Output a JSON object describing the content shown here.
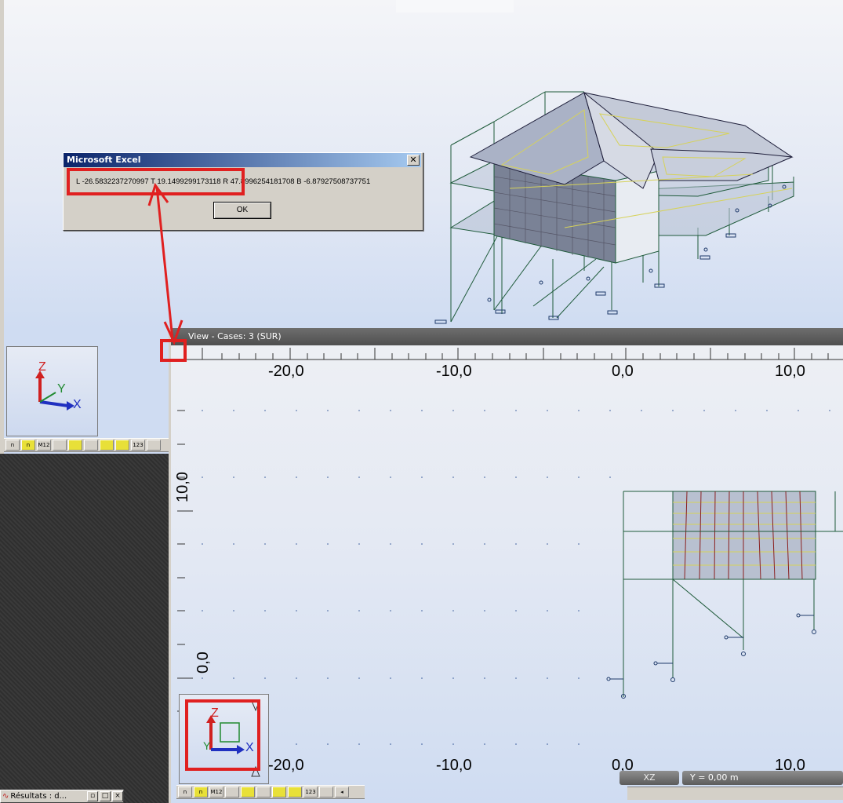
{
  "view3d": {},
  "left_panel": {
    "axes": {
      "z": "Z",
      "y": "Y",
      "x": "X"
    },
    "toolbar": [
      "n",
      "n",
      "M12",
      "",
      "",
      "",
      "",
      "",
      "123",
      ""
    ]
  },
  "view2d": {
    "title": "View - Cases: 3 (SUR)",
    "ruler_top": [
      "-20,0",
      "-10,0",
      "0,0",
      "10,0"
    ],
    "ruler_bottom": [
      "-20,0",
      "-10,0",
      "0,0",
      "10,0"
    ],
    "ruler_left": [
      "10,0",
      "0,0"
    ],
    "axes": {
      "z": "Z",
      "y": "Y",
      "x": "X"
    },
    "toolbar": [
      "n",
      "n",
      "M12",
      "",
      "",
      "",
      "",
      "",
      "123",
      ""
    ],
    "status_plane": "XZ",
    "status_coord": "Y = 0,00 m"
  },
  "excel_dialog": {
    "title": "Microsoft Excel",
    "close": "✕",
    "message": "L -26.5832237270997  T  19.1499299173118  R  47.8996254181708 B -6.87927508737751",
    "ok": "OK"
  },
  "taskbar": {
    "label": "Résultats : d..."
  },
  "colors": {
    "annotation": "#e02020",
    "structure": "#1e5a3a",
    "title_bar": "#0a246a"
  }
}
